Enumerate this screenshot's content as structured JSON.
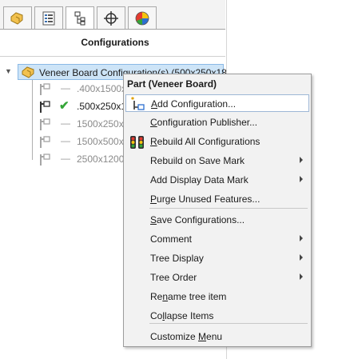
{
  "panel": {
    "tabs": [
      {
        "icon": "feature-manager-icon"
      },
      {
        "icon": "property-manager-icon"
      },
      {
        "icon": "configuration-manager-icon"
      },
      {
        "icon": "dimxpert-icon"
      },
      {
        "icon": "display-manager-icon"
      }
    ],
    "section_title": "Configurations",
    "root": {
      "label": "Veneer Board Configuration(s)  (500x250x18"
    },
    "configs": [
      {
        "label": ".400x1500x",
        "active": false
      },
      {
        "label": ".500x250x1",
        "active": true
      },
      {
        "label": "1500x250x1",
        "active": false
      },
      {
        "label": "1500x500x1",
        "active": false
      },
      {
        "label": "2500x1200x",
        "active": false
      }
    ]
  },
  "menu": {
    "header": "Part (Veneer Board)",
    "items": [
      {
        "pre": "",
        "u": "A",
        "post": "dd Configuration...",
        "submenu": false,
        "icon": "add-configuration-icon",
        "hover": true
      },
      {
        "pre": "",
        "u": "C",
        "post": "onfiguration Publisher...",
        "submenu": false,
        "icon": "",
        "hover": false
      },
      {
        "pre": "",
        "u": "R",
        "post": "ebuild All Configurations",
        "submenu": false,
        "icon": "traffic-light-icon",
        "hover": false
      },
      {
        "pre": "Rebuild on Save Mark",
        "u": "",
        "post": "",
        "submenu": true,
        "icon": "",
        "hover": false
      },
      {
        "pre": "Add Display Data Mark",
        "u": "",
        "post": "",
        "submenu": true,
        "icon": "",
        "hover": false
      },
      {
        "pre": "",
        "u": "P",
        "post": "urge Unused Features...",
        "submenu": false,
        "icon": "",
        "hover": false
      },
      {
        "pre": "",
        "u": "S",
        "post": "ave Configurations...",
        "submenu": false,
        "icon": "",
        "hover": false
      },
      {
        "pre": "Comment",
        "u": "",
        "post": "",
        "submenu": true,
        "icon": "",
        "hover": false
      },
      {
        "pre": "Tree Display",
        "u": "",
        "post": "",
        "submenu": true,
        "icon": "",
        "hover": false
      },
      {
        "pre": "Tree Order",
        "u": "",
        "post": "",
        "submenu": true,
        "icon": "",
        "hover": false
      },
      {
        "pre": "Re",
        "u": "n",
        "post": "ame tree item",
        "submenu": false,
        "icon": "",
        "hover": false
      },
      {
        "pre": "Co",
        "u": "l",
        "post": "lapse Items",
        "submenu": false,
        "icon": "",
        "hover": false
      },
      {
        "pre": "Customize ",
        "u": "M",
        "post": "enu",
        "submenu": false,
        "icon": "",
        "hover": false
      }
    ]
  }
}
